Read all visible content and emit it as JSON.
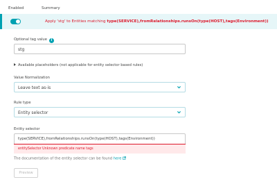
{
  "tabs": {
    "enabled": "Enabled",
    "summary": "Summary"
  },
  "rule": {
    "prefix": "Apply 'stg' to Entities matching ",
    "selector": "type(SERVICE),fromRelationships.runsOn(type(HOST),tags(Environment))",
    "enabled": true
  },
  "tag_value": {
    "label": "Optional tag value",
    "value": "stg",
    "info_icon": "info-icon"
  },
  "placeholders": {
    "label": "Available placeholders (not applicable for entity selector based rules)"
  },
  "value_normalization": {
    "label": "Value Normalization",
    "selected": "Leave text as-is"
  },
  "rule_type": {
    "label": "Rule type",
    "selected": "Entity selector"
  },
  "entity_selector": {
    "label": "Entity selector",
    "value": "type(SERVICE),fromRelationships.runsOn(type(HOST),tags(Environment))",
    "error": "entitySelector Unknown predicate name tags"
  },
  "documentation": {
    "text": "The documentation of the entity selector can be found ",
    "link": "here"
  },
  "preview_button": {
    "label": "Preview"
  },
  "colors": {
    "accent": "#00a1b2",
    "error": "#dc172a",
    "error_bg": "#ffe9ea",
    "row_bg": "#e6f6f8"
  }
}
